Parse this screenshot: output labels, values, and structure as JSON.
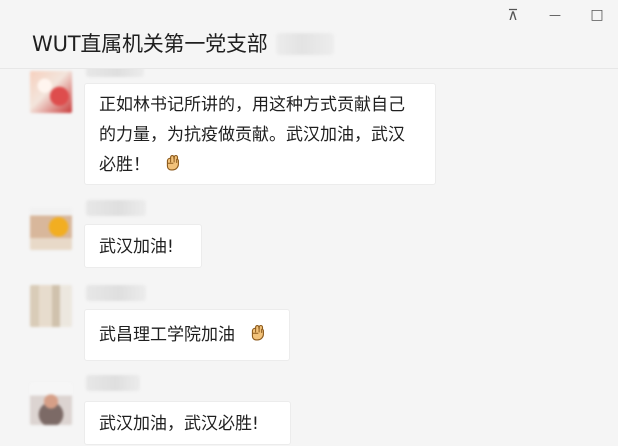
{
  "window": {
    "title": "WUT直属机关第一党支部",
    "member_count": "( )",
    "controls": {
      "pin_icon": "pin-icon",
      "minimize_icon": "minimize-icon",
      "maximize_icon": "maximize-icon"
    }
  },
  "messages": [
    {
      "sender": "",
      "text": "正如林书记所讲的，用这种方式贡献自己的力量，为抗疫做贡献。武汉加油，武汉必胜！",
      "emoji": "fist-icon"
    },
    {
      "sender": "",
      "text": "武汉加油!",
      "emoji": ""
    },
    {
      "sender": "",
      "text": "武昌理工学院加油",
      "emoji": "fist-icon"
    },
    {
      "sender": "",
      "text": "武汉加油，武汉必胜!",
      "emoji": ""
    }
  ],
  "colors": {
    "background": "#f5f5f5",
    "bubble": "#ffffff",
    "text": "#1f1f1f",
    "border": "#ececec"
  }
}
